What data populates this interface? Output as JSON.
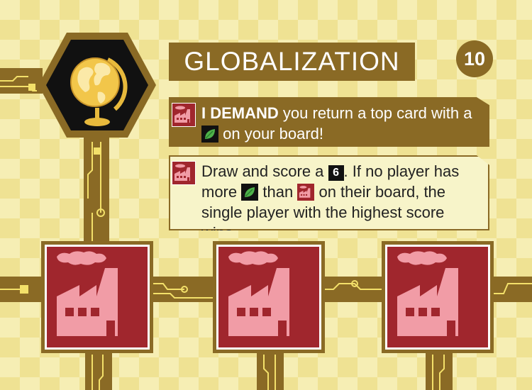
{
  "card": {
    "title": "GLOBALIZATION",
    "age": "10",
    "colors": {
      "background": "#f6eeb4",
      "accent": "#8a6a25",
      "factory": "#a0262d",
      "factory_pink": "#f19ca6",
      "leaf": "#2f9a3c",
      "globe_gold": "#f2c64a",
      "hex_black": "#111111"
    },
    "main_icon": "globe-icon",
    "bottom_icons": [
      "factory-icon",
      "factory-icon",
      "factory-icon"
    ]
  },
  "dogma": {
    "demand": {
      "icon": "factory-icon",
      "keyword": "I DEMAND",
      "text_before_icon": "you return a top card with a",
      "inline_icon": "leaf-icon",
      "text_after_icon": "on your board!"
    },
    "cooperative": {
      "icon": "factory-icon",
      "text_1": "Draw and score a",
      "age_number": "6",
      "text_2": ". If no player has more",
      "inline_icon_1": "leaf-icon",
      "text_3": "than",
      "inline_icon_2": "factory-icon",
      "text_4": "on their board, the single player with the highest score wins."
    }
  }
}
